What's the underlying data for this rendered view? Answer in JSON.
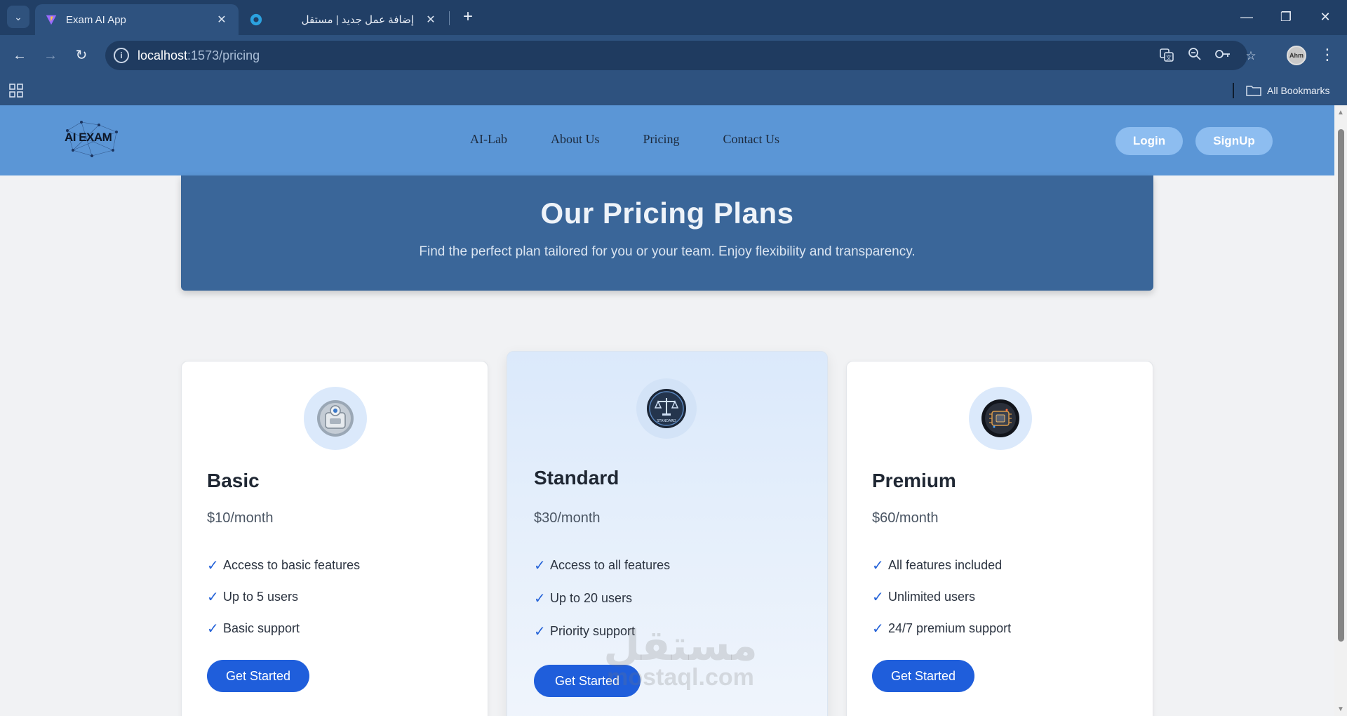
{
  "browser": {
    "tabs": [
      {
        "title": "Exam AI App",
        "active": true
      },
      {
        "title": "إضافة عمل جديد | مستقل",
        "active": false
      }
    ],
    "new_tab_label": "+",
    "address": {
      "host": "localhost",
      "path": ":1573/pricing"
    },
    "bookmarks_label": "All Bookmarks",
    "profile_initials": "Ahm",
    "icons": [
      "tab-search-icon",
      "back-icon",
      "forward-icon",
      "reload-icon",
      "site-info-icon",
      "translate-icon",
      "zoom-icon",
      "password-key-icon",
      "bookmark-star-icon",
      "menu-icon",
      "apps-icon",
      "folder-icon",
      "minimize-icon",
      "restore-icon",
      "close-icon"
    ]
  },
  "site": {
    "logo_text": "AI EXAM",
    "nav": [
      "AI-Lab",
      "About Us",
      "Pricing",
      "Contact Us"
    ],
    "login_label": "Login",
    "signup_label": "SignUp"
  },
  "hero": {
    "title": "Our Pricing Plans",
    "subtitle": "Find the perfect plan tailored for you or your team. Enjoy flexibility and transparency."
  },
  "plans": [
    {
      "name": "Basic",
      "price": "$10/month",
      "features": [
        "Access to basic features",
        "Up to 5 users",
        "Basic support"
      ],
      "cta": "Get Started",
      "icon": "robot-safe-icon"
    },
    {
      "name": "Standard",
      "price": "$30/month",
      "features": [
        "Access to all features",
        "Up to 20 users",
        "Priority support"
      ],
      "cta": "Get Started",
      "icon": "scales-badge-icon",
      "badge_text": "STANDARD"
    },
    {
      "name": "Premium",
      "price": "$60/month",
      "features": [
        "All features included",
        "Unlimited users",
        "24/7 premium support"
      ],
      "cta": "Get Started",
      "icon": "chip-icon"
    }
  ],
  "watermark": {
    "arabic": "مستقل",
    "latin": "mostaql.com"
  },
  "colors": {
    "accent": "#1f5edb",
    "nav": "#5b96d6",
    "hero": "#3a6699",
    "check": "#2563d8"
  }
}
